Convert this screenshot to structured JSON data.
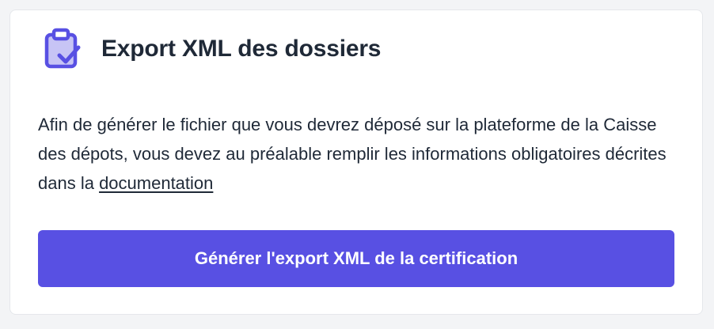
{
  "card": {
    "icon": "clipboard-check-icon",
    "title": "Export XML des dossiers",
    "description_prefix": "Afin de générer le fichier que vous devrez déposé sur la plateforme de la Caisse des dépots, vous devez au préalable remplir les informations obligatoires décrites dans la ",
    "documentation_link": "documentation",
    "export_button_label": "Générer l'export XML de la certification"
  },
  "colors": {
    "accent": "#5850e3",
    "icon_light": "#c7c4f5",
    "text": "#1f2937",
    "page_background": "#f3f4f6",
    "card_background": "#ffffff"
  }
}
